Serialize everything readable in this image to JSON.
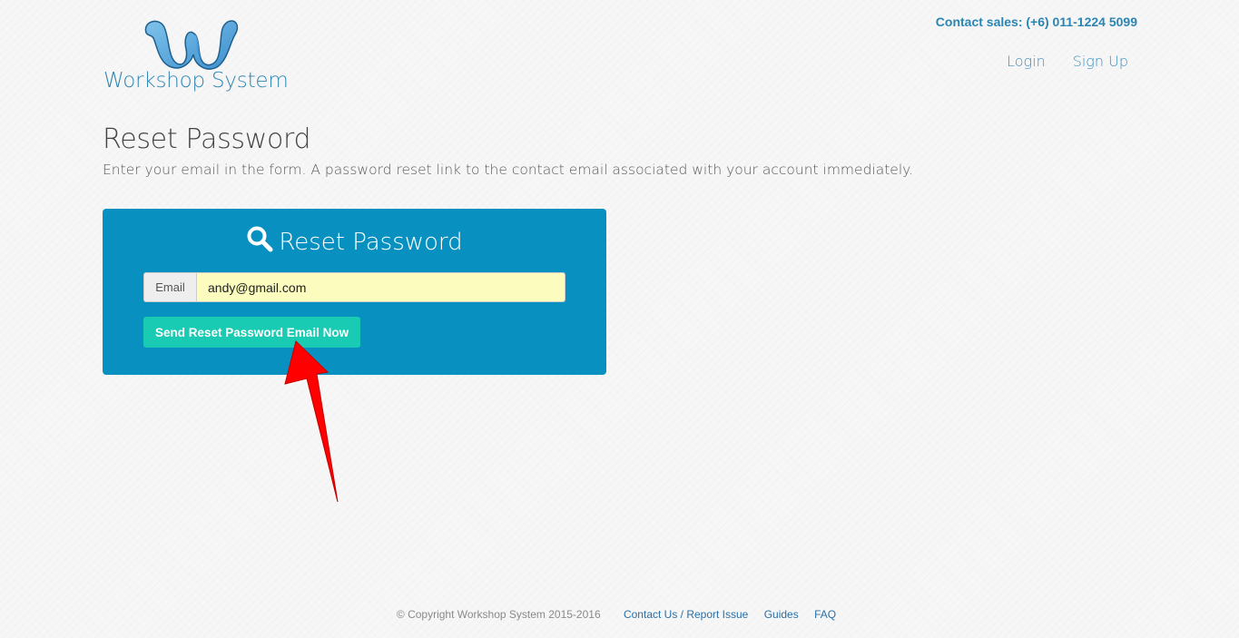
{
  "header": {
    "logo_text": "Workshop System",
    "contact_sales": "Contact sales: (+6) 011-1224 5099",
    "nav": {
      "login": "Login",
      "signup": "Sign Up"
    }
  },
  "page": {
    "title": "Reset Password",
    "subtitle": "Enter your email in the form. A password reset link to the contact email associated with your account immediately."
  },
  "reset_form": {
    "card_title": "Reset Password",
    "email_label": "Email",
    "email_value": "andy@gmail.com",
    "submit_label": "Send Reset Password Email Now"
  },
  "footer": {
    "copyright": "© Copyright Workshop System 2015-2016",
    "links": {
      "contact": "Contact Us / Report Issue",
      "guides": "Guides",
      "faq": "FAQ"
    }
  },
  "colors": {
    "brand": "#2f86b3",
    "card_background": "#0891c0",
    "button": "#19cbb2",
    "input_autofill": "#fbfcbd",
    "annotation_arrow": "#ff0000"
  },
  "icons": {
    "card_title": "search-icon",
    "annotation": "red-arrow-icon"
  }
}
